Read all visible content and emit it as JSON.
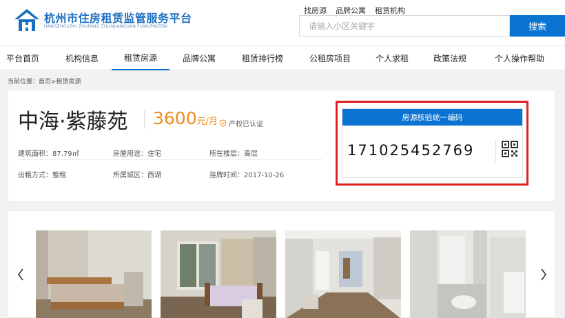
{
  "header": {
    "logo_title": "杭州市住房租赁监管服务平台",
    "logo_subtitle": "HANGZHOUSHI ZHUFANG ZULINJIANGUAN FUWUPINGTAI",
    "top_links": [
      "找房源",
      "品牌公寓",
      "租赁机构"
    ],
    "search_placeholder": "请输入小区关键字",
    "search_button": "搜索"
  },
  "nav": {
    "items": [
      "平台首页",
      "机构信息",
      "租赁房源",
      "品牌公寓",
      "租赁排行榜",
      "公租房项目",
      "个人求租",
      "政策法规",
      "个人操作帮助"
    ],
    "active_index": 2
  },
  "breadcrumb": "当前位置：首页>租赁房源",
  "listing": {
    "title": "中海·紫藤苑",
    "price": "3600",
    "price_unit": "元/月",
    "verified_label": "产权已认证",
    "attributes": [
      [
        "建筑面积：87.79㎡",
        "房屋用途：住宅",
        "所在楼层：高层"
      ],
      [
        "出租方式：整租",
        "所属城区：西湖",
        "挂牌时间：2017-10-26"
      ]
    ]
  },
  "verification": {
    "header": "房源核验统一编码",
    "code": "171025452769",
    "qr_icon": "qr-code-icon"
  },
  "gallery": {
    "prev_icon": "chevron-left-icon",
    "next_icon": "chevron-right-icon",
    "photos": [
      "bedroom-photo",
      "bedroom-window-photo",
      "living-room-photo",
      "bathroom-photo"
    ]
  },
  "colors": {
    "brand_blue": "#0a72d1",
    "price_orange": "#f08a1c",
    "highlight_red": "#e02020"
  }
}
